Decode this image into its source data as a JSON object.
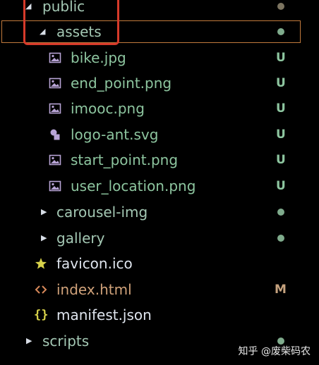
{
  "colors": {
    "background": "#000000",
    "folder_text": "#a4c8b4",
    "file_text": "#8dc59f",
    "modified_text": "#d0a27a",
    "plain_text": "#dfe5ee",
    "untracked_badge": "#8dc59f",
    "modified_badge": "#c5a27e",
    "dot_green": "#7fab8c",
    "dot_brown": "#7c7460",
    "selection_border": "#c27a3c",
    "annotation_border": "#d63a2a"
  },
  "tree": [
    {
      "name": "public",
      "type": "folder",
      "expanded": true,
      "badge": "dot",
      "badge_color": "brown"
    },
    {
      "name": "assets",
      "type": "folder",
      "expanded": true,
      "badge": "dot",
      "badge_color": "green",
      "selected": true
    },
    {
      "name": "bike.jpg",
      "type": "image",
      "icon": "image-icon",
      "status": "U"
    },
    {
      "name": "end_point.png",
      "type": "image",
      "icon": "image-icon",
      "status": "U"
    },
    {
      "name": "imooc.png",
      "type": "image",
      "icon": "image-icon",
      "status": "U"
    },
    {
      "name": "logo-ant.svg",
      "type": "svg",
      "icon": "svg-shapes-icon",
      "status": "U"
    },
    {
      "name": "start_point.png",
      "type": "image",
      "icon": "image-icon",
      "status": "U"
    },
    {
      "name": "user_location.png",
      "type": "image",
      "icon": "image-icon",
      "status": "U"
    },
    {
      "name": "carousel-img",
      "type": "folder",
      "expanded": false,
      "badge": "dot",
      "badge_color": "green"
    },
    {
      "name": "gallery",
      "type": "folder",
      "expanded": false,
      "badge": "dot",
      "badge_color": "green"
    },
    {
      "name": "favicon.ico",
      "type": "ico",
      "icon": "star-icon"
    },
    {
      "name": "index.html",
      "type": "html",
      "icon": "code-brackets-icon",
      "status": "M"
    },
    {
      "name": "manifest.json",
      "type": "json",
      "icon": "curly-braces-icon"
    },
    {
      "name": "scripts",
      "type": "folder",
      "expanded": false,
      "badge": "dot",
      "badge_color": "green"
    }
  ],
  "watermark": "知乎 @废柴码农"
}
